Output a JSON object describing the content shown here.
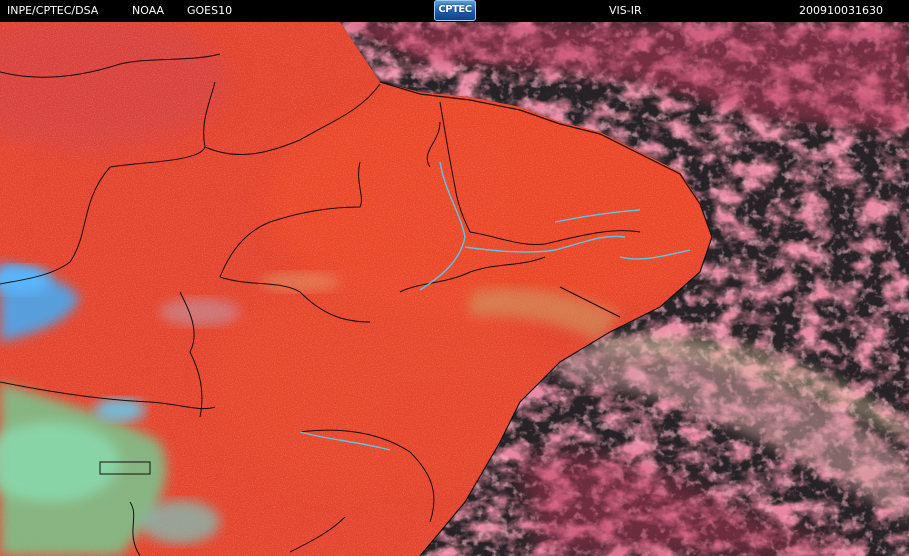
{
  "header": {
    "agency": "INPE/CPTEC/DSA",
    "source": "NOAA",
    "satellite": "GOES10",
    "logo_text": "CPTEC",
    "channel": "VIS-IR",
    "timestamp": "200910031630"
  },
  "colors": {
    "land_warm": "#e8442a",
    "cloud_high": "#4aa8f0",
    "cloud_mid": "#7cd09a",
    "ocean_clear": "#1e1e1e",
    "ocean_cloud": "#c23a5a",
    "boundary_line": "#000000",
    "river_line": "#55ccee"
  }
}
